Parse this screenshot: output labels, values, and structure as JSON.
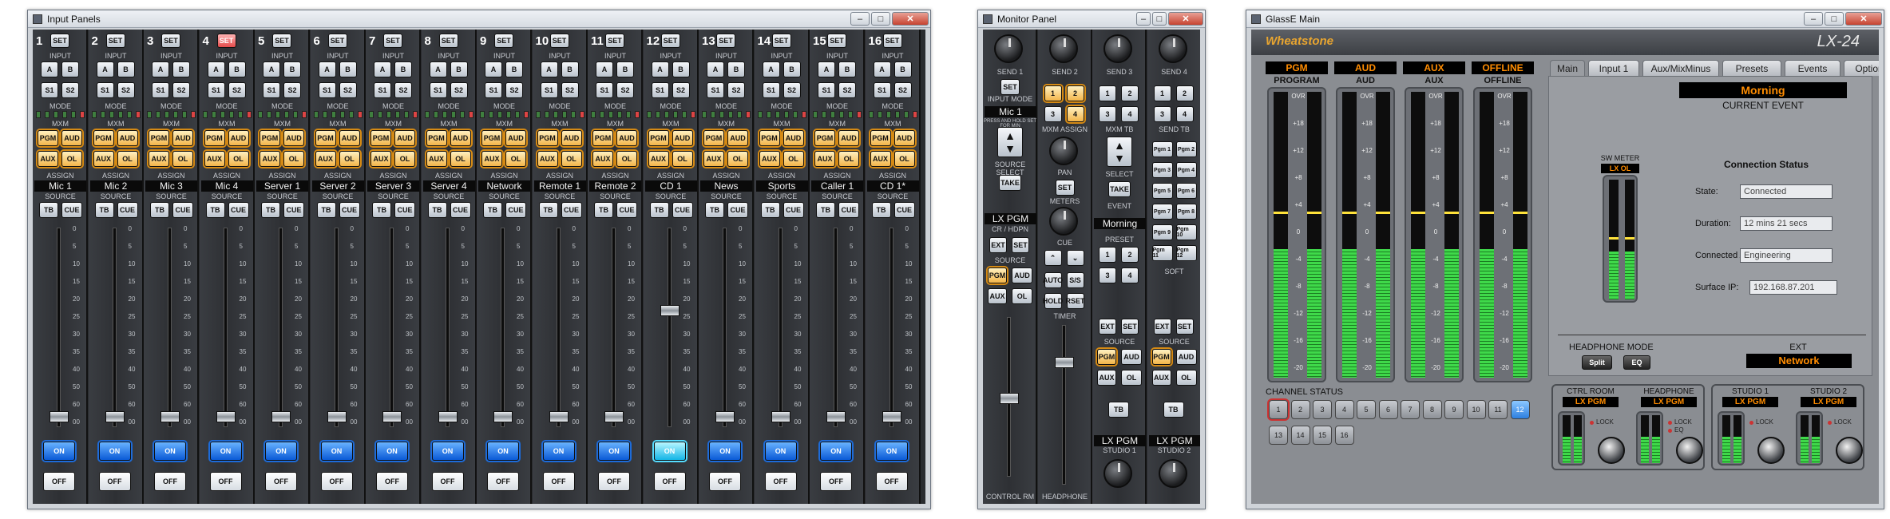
{
  "input_panels": {
    "title": "Input Panels",
    "strips": [
      {
        "num": "1",
        "source": "Mic 1"
      },
      {
        "num": "2",
        "source": "Mic 2"
      },
      {
        "num": "3",
        "source": "Mic 3"
      },
      {
        "num": "4",
        "source": "Mic 4"
      },
      {
        "num": "5",
        "source": "Server 1"
      },
      {
        "num": "6",
        "source": "Server 2"
      },
      {
        "num": "7",
        "source": "Server 3"
      },
      {
        "num": "8",
        "source": "Server 4"
      },
      {
        "num": "9",
        "source": "Network"
      },
      {
        "num": "10",
        "source": "Remote 1"
      },
      {
        "num": "11",
        "source": "Remote 2"
      },
      {
        "num": "12",
        "source": "CD 1"
      },
      {
        "num": "13",
        "source": "News"
      },
      {
        "num": "14",
        "source": "Sports"
      },
      {
        "num": "15",
        "source": "Caller 1"
      },
      {
        "num": "16",
        "source": "CD 1*"
      }
    ],
    "labels": {
      "set": "SET",
      "input": "INPUT",
      "a": "A",
      "b": "B",
      "s1": "S1",
      "s2": "S2",
      "mode": "MODE",
      "mxm": "MXM",
      "pgm": "PGM",
      "aud": "AUD",
      "aux": "AUX",
      "ol": "OL",
      "assign": "ASSIGN",
      "source": "SOURCE",
      "tb": "TB",
      "cue": "CUE",
      "on": "ON",
      "off": "OFF"
    },
    "scale": [
      "0",
      "5",
      "10",
      "15",
      "20",
      "25",
      "30",
      "35",
      "40",
      "50",
      "60",
      "00"
    ]
  },
  "monitor_panel": {
    "title": "Monitor Panel",
    "sends": [
      "SEND 1",
      "SEND 2",
      "SEND 3",
      "SEND 4"
    ],
    "input_mode": "INPUT MODE",
    "mic_label": "Mic 1",
    "press_hold": "PRESS AND HOLD SET FOR MIN",
    "source_select": "SOURCE SELECT",
    "take": "TAKE",
    "mxm_assign": "MXM ASSIGN",
    "mxm_tb": "MXM TB",
    "send_tb": "SEND TB",
    "pan": "PAN",
    "select": "SELECT",
    "set": "SET",
    "meters": "METERS",
    "event": "EVENT",
    "event_value": "Morning",
    "lx_pgm": "LX PGM",
    "cr_hdpn": "CR / HDPN",
    "cue": "CUE",
    "preset": "PRESET",
    "source": "SOURCE",
    "soft": "SOFT",
    "ext": "EXT",
    "pgm": "PGM",
    "aud": "AUD",
    "aux": "AUX",
    "ol": "OL",
    "auto": "AUTO",
    "ss": "S/S",
    "hold": "HOLD",
    "reset": "RSET",
    "timer": "TIMER",
    "tb": "TB",
    "studio1": "STUDIO 1",
    "studio2": "STUDIO 2",
    "control_rm": "CONTROL RM",
    "headphone": "HEADPHONE",
    "pgm_buttons": [
      "Pgm 1",
      "Pgm 2",
      "Pgm 3",
      "Pgm 4",
      "Pgm 5",
      "Pgm 6",
      "Pgm 7",
      "Pgm 8",
      "Pgm 9",
      "Pgm 10",
      "Pgm 11",
      "Pgm 12"
    ]
  },
  "glasse": {
    "title": "GlassE Main",
    "logo": "Wheatstone",
    "model": "LX-24",
    "buses": [
      {
        "tag": "PGM",
        "name": "PROGRAM",
        "level": 0.45
      },
      {
        "tag": "AUD",
        "name": "AUD",
        "level": 0.45
      },
      {
        "tag": "AUX",
        "name": "AUX",
        "level": 0.45
      },
      {
        "tag": "OFFLINE",
        "name": "OFFLINE",
        "level": 0.45
      }
    ],
    "meter_scale": [
      "OVR",
      "+18",
      "+12",
      "+8",
      "+4",
      "0",
      "-4",
      "-8",
      "-12",
      "-16",
      "-20"
    ],
    "tabs": [
      "Main",
      "Input 1",
      "Aux/MixMinus",
      "Presets",
      "Events",
      "Options"
    ],
    "current_event": {
      "value": "Morning",
      "label": "CURRENT EVENT"
    },
    "sw_meter": {
      "title": "SW METER",
      "sub": "LX OL"
    },
    "connection": {
      "title": "Connection Status",
      "state_label": "State:",
      "state": "Connected",
      "duration_label": "Duration:",
      "duration": "12 mins 21 secs",
      "as_label": "Connected As:",
      "as": "Engineering",
      "ip_label": "Surface IP:",
      "ip": "192.168.87.201"
    },
    "headphone_mode": {
      "label": "HEADPHONE MODE",
      "split": "Split",
      "eq": "EQ"
    },
    "ext": {
      "label": "EXT",
      "value": "Network"
    },
    "channel_status": {
      "label": "CHANNEL STATUS",
      "channels": [
        "1",
        "2",
        "3",
        "4",
        "5",
        "6",
        "7",
        "8",
        "9",
        "10",
        "11",
        "12",
        "13",
        "14",
        "15",
        "16"
      ]
    },
    "monitors": [
      {
        "name": "CTRL ROOM",
        "src": "LX PGM",
        "lock": "LOCK"
      },
      {
        "name": "HEADPHONE",
        "src": "LX PGM",
        "lock": "LOCK",
        "eq": "EQ"
      },
      {
        "name": "STUDIO 1",
        "src": "LX PGM",
        "lock": "LOCK"
      },
      {
        "name": "STUDIO 2",
        "src": "LX PGM",
        "lock": "LOCK"
      }
    ]
  }
}
